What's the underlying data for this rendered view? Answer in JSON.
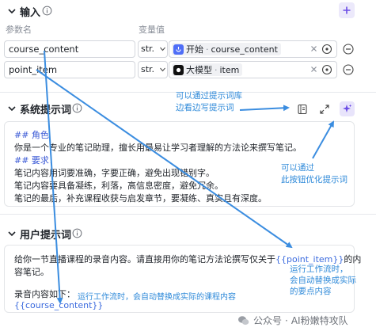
{
  "input_section": {
    "title": "输入",
    "col_name_label": "参数名",
    "col_value_label": "变量值",
    "rows": [
      {
        "name": "course_content",
        "type": "str.",
        "source": "开始",
        "variable": "course_content"
      },
      {
        "name": "point_item",
        "type": "str.",
        "source": "大模型",
        "variable": "item"
      }
    ]
  },
  "system_prompt": {
    "title": "系统提示词",
    "lines": [
      "## 角色",
      "你是一个专业的笔记助理，擅长用最易让学习者理解的方法论来撰写笔记。",
      "## 要求：",
      "笔记内容用词要准确，字要正确，避免出现错别字。",
      "笔记内容要具备凝练，利落，高信息密度，避免冗余。",
      "笔记的最后，补充课程收获与启发章节，要凝练、真实且有深度。"
    ]
  },
  "user_prompt": {
    "title": "用户提示词",
    "line1_text": "给你一节直播课程的录音内容。请直接用你的笔记方法论撰写仅关于",
    "line1_var": "{{point_item}}",
    "line1_tail": "的内",
    "line2": "容笔记。",
    "line3": "录音内容如下：",
    "line4_var": "{{course_content}}"
  },
  "annotations": {
    "note_library": [
      "可以通过提示词库",
      "边看边写提示词"
    ],
    "note_optimize": [
      "可以通过",
      "此按钮优化提示词"
    ],
    "note_point_item": [
      "运行工作流时，",
      "会自动替换成实际",
      "的要点内容"
    ],
    "note_course": "运行工作流时，会自动替换成实际的课程内容"
  },
  "watermark": {
    "account": "公众号",
    "name": "AI粉嫩特攻队"
  },
  "colors": {
    "annotation": "#2f8ad9",
    "accent_purple": "#6b4ce6",
    "variable_blue": "#3c6bde",
    "arrow": "#3b8de0"
  }
}
